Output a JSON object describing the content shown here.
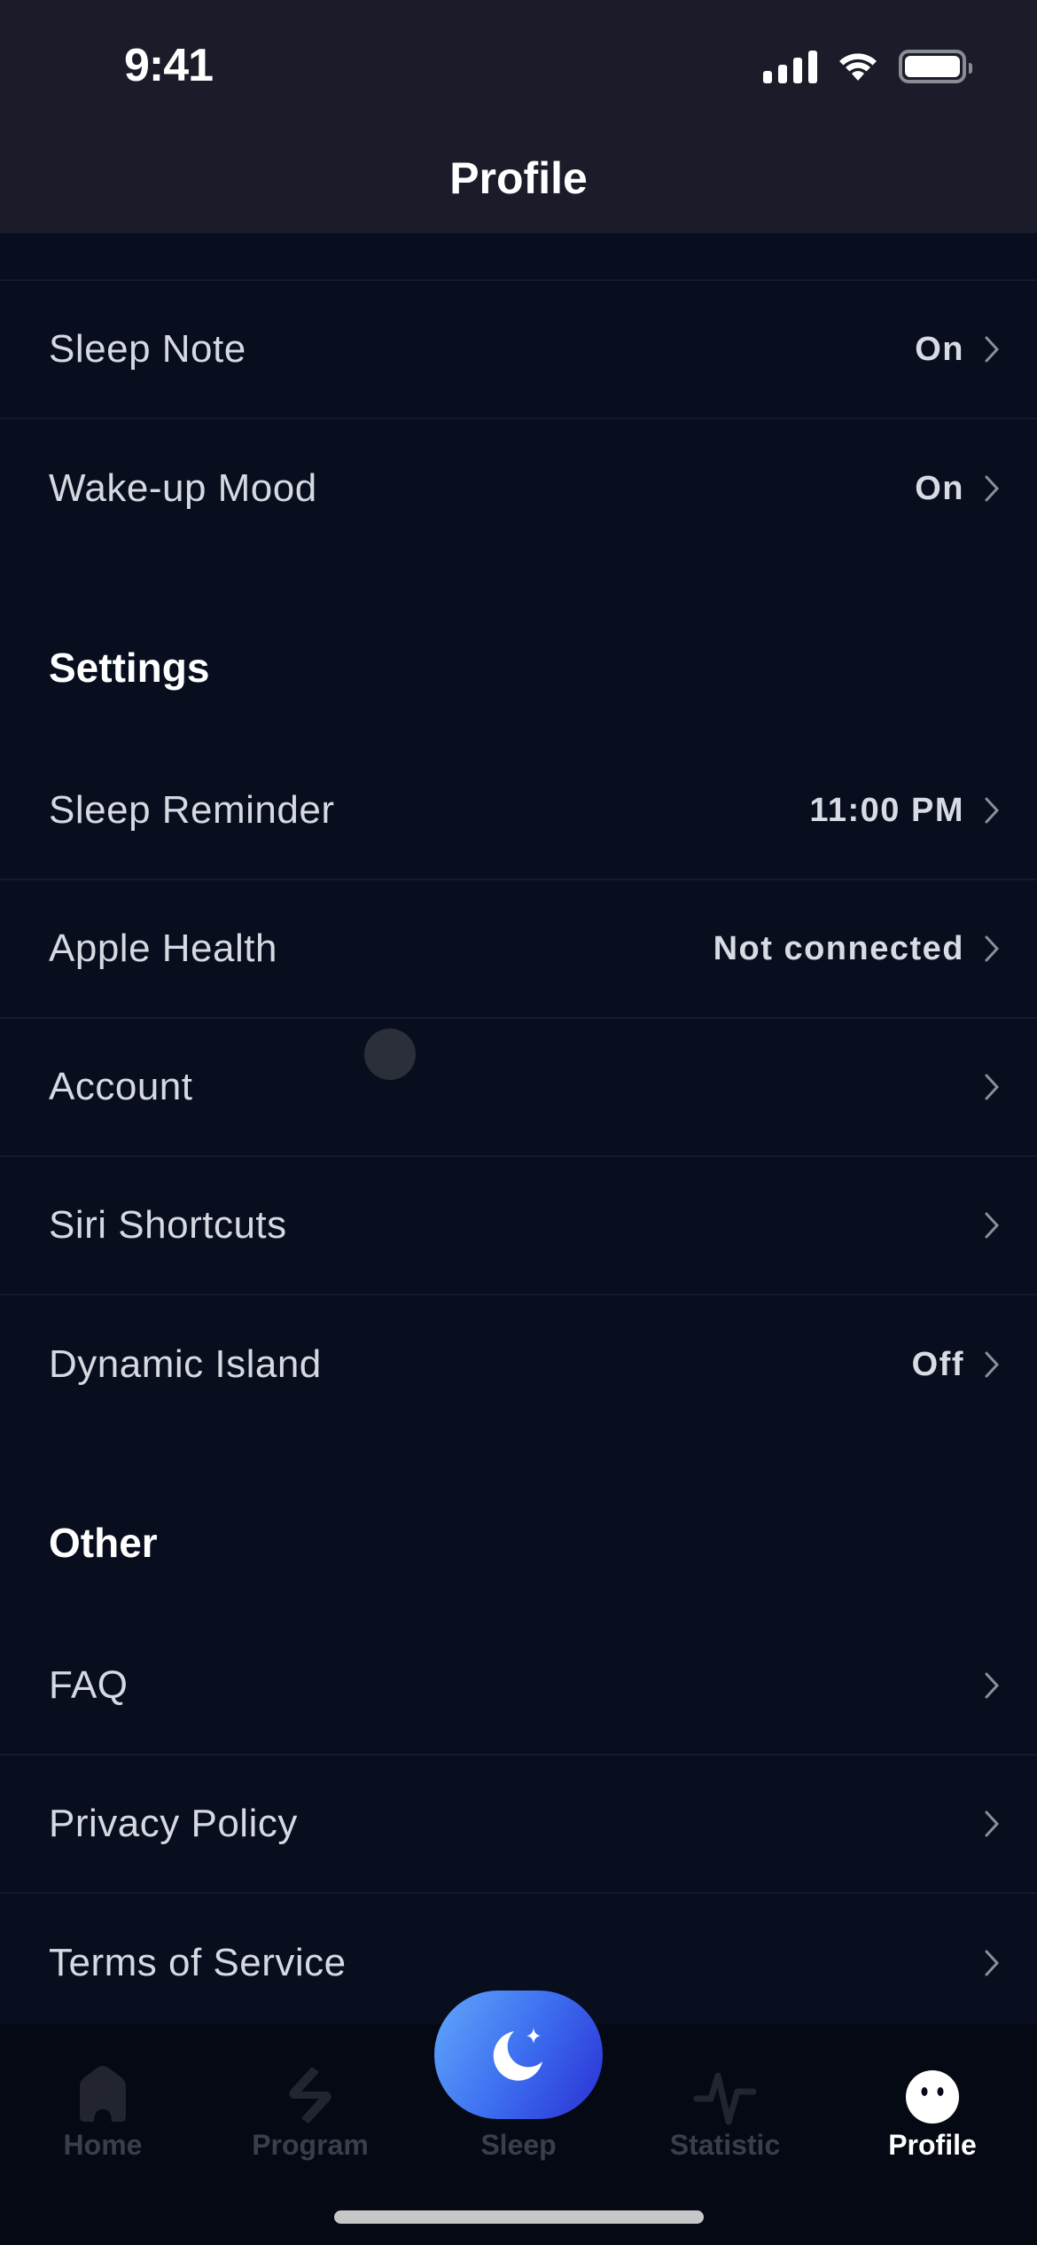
{
  "status_bar": {
    "time": "9:41"
  },
  "header": {
    "title": "Profile"
  },
  "sections": {
    "top_rows": [
      {
        "label": "Sleep Note",
        "value": "On"
      },
      {
        "label": "Wake-up Mood",
        "value": "On"
      }
    ],
    "settings": {
      "title": "Settings",
      "rows": [
        {
          "label": "Sleep Reminder",
          "value": "11:00 PM"
        },
        {
          "label": "Apple Health",
          "value": "Not connected"
        },
        {
          "label": "Account",
          "value": ""
        },
        {
          "label": "Siri Shortcuts",
          "value": ""
        },
        {
          "label": "Dynamic Island",
          "value": "Off"
        }
      ]
    },
    "other": {
      "title": "Other",
      "rows": [
        {
          "label": "FAQ",
          "value": ""
        },
        {
          "label": "Privacy Policy",
          "value": ""
        },
        {
          "label": "Terms of Service",
          "value": ""
        }
      ]
    }
  },
  "tabbar": {
    "tabs": [
      {
        "label": "Home",
        "icon": "home-icon",
        "active": false
      },
      {
        "label": "Program",
        "icon": "program-icon",
        "active": false
      },
      {
        "label": "Sleep",
        "icon": "moon-star-icon",
        "active": false
      },
      {
        "label": "Statistic",
        "icon": "pulse-icon",
        "active": false
      },
      {
        "label": "Profile",
        "icon": "face-icon",
        "active": true
      }
    ]
  },
  "colors": {
    "background": "#080e1e",
    "header": "#1a1d29",
    "tabbar": "#050914",
    "accent_gradient_start": "#62a7fb",
    "accent_gradient_end": "#2a2fd4",
    "inactive_tab": "#3a3e4a"
  }
}
